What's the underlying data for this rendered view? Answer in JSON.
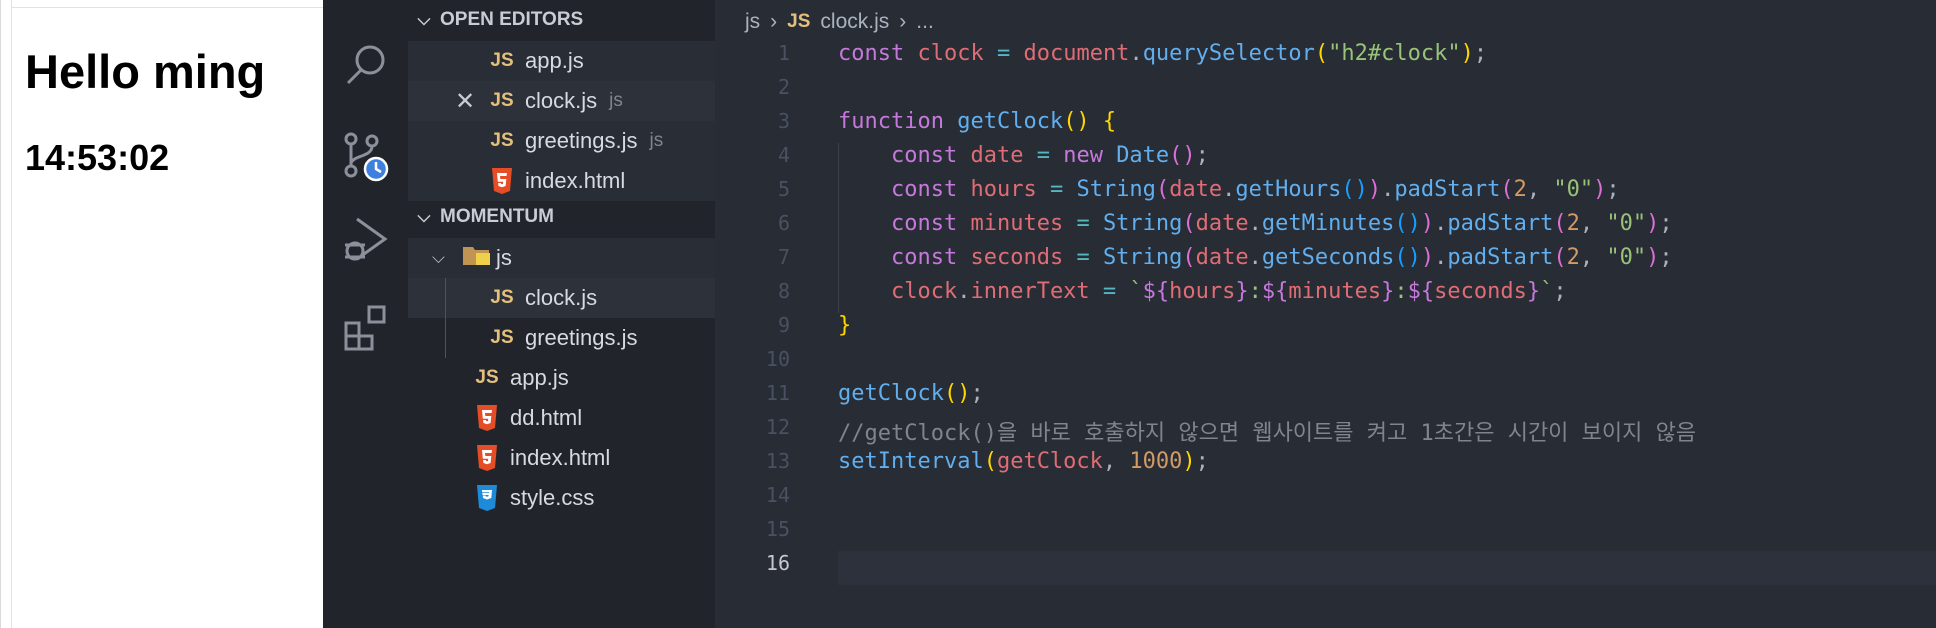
{
  "preview": {
    "heading": "Hello ming",
    "clock": "14:53:02"
  },
  "explorer": {
    "open_editors": {
      "title": "OPEN EDITORS",
      "items": [
        {
          "icon": "JS",
          "name": "app.js",
          "desc": ""
        },
        {
          "icon": "JS",
          "name": "clock.js",
          "desc": "js"
        },
        {
          "icon": "JS",
          "name": "greetings.js",
          "desc": "js"
        },
        {
          "icon": "html",
          "name": "index.html",
          "desc": ""
        }
      ]
    },
    "project": {
      "title": "MOMENTUM",
      "folder": "js",
      "items": [
        {
          "icon": "JS",
          "name": "clock.js"
        },
        {
          "icon": "JS",
          "name": "greetings.js"
        },
        {
          "icon": "JS",
          "name": "app.js"
        },
        {
          "icon": "html",
          "name": "dd.html"
        },
        {
          "icon": "html",
          "name": "index.html"
        },
        {
          "icon": "css",
          "name": "style.css"
        }
      ]
    }
  },
  "editor": {
    "breadcrumb": {
      "folder": "js",
      "file_icon": "JS",
      "file": "clock.js",
      "more": "..."
    },
    "current_line": 16,
    "lines": [
      [
        [
          "kw",
          "const "
        ],
        [
          "var",
          "clock "
        ],
        [
          "op",
          "= "
        ],
        [
          "var",
          "document"
        ],
        [
          "pl",
          "."
        ],
        [
          "fn",
          "querySelector"
        ],
        [
          "br1",
          "("
        ],
        [
          "str",
          "\"h2#clock\""
        ],
        [
          "br1",
          ")"
        ],
        [
          "pl",
          ";"
        ]
      ],
      [],
      [
        [
          "kw",
          "function "
        ],
        [
          "fn",
          "getClock"
        ],
        [
          "br1",
          "() {"
        ]
      ],
      [
        [
          "pl",
          "    "
        ],
        [
          "kw",
          "const "
        ],
        [
          "var",
          "date "
        ],
        [
          "op",
          "= "
        ],
        [
          "kw",
          "new "
        ],
        [
          "fn",
          "Date"
        ],
        [
          "br2",
          "()"
        ],
        [
          "pl",
          ";"
        ]
      ],
      [
        [
          "pl",
          "    "
        ],
        [
          "kw",
          "const "
        ],
        [
          "var",
          "hours "
        ],
        [
          "op",
          "= "
        ],
        [
          "fn",
          "String"
        ],
        [
          "br2",
          "("
        ],
        [
          "var",
          "date"
        ],
        [
          "pl",
          "."
        ],
        [
          "fn",
          "getHours"
        ],
        [
          "br3",
          "()"
        ],
        [
          "br2",
          ")"
        ],
        [
          "pl",
          "."
        ],
        [
          "fn",
          "padStart"
        ],
        [
          "br2",
          "("
        ],
        [
          "num",
          "2"
        ],
        [
          "pl",
          ", "
        ],
        [
          "str",
          "\"0\""
        ],
        [
          "br2",
          ")"
        ],
        [
          "pl",
          ";"
        ]
      ],
      [
        [
          "pl",
          "    "
        ],
        [
          "kw",
          "const "
        ],
        [
          "var",
          "minutes "
        ],
        [
          "op",
          "= "
        ],
        [
          "fn",
          "String"
        ],
        [
          "br2",
          "("
        ],
        [
          "var",
          "date"
        ],
        [
          "pl",
          "."
        ],
        [
          "fn",
          "getMinutes"
        ],
        [
          "br3",
          "()"
        ],
        [
          "br2",
          ")"
        ],
        [
          "pl",
          "."
        ],
        [
          "fn",
          "padStart"
        ],
        [
          "br2",
          "("
        ],
        [
          "num",
          "2"
        ],
        [
          "pl",
          ", "
        ],
        [
          "str",
          "\"0\""
        ],
        [
          "br2",
          ")"
        ],
        [
          "pl",
          ";"
        ]
      ],
      [
        [
          "pl",
          "    "
        ],
        [
          "kw",
          "const "
        ],
        [
          "var",
          "seconds "
        ],
        [
          "op",
          "= "
        ],
        [
          "fn",
          "String"
        ],
        [
          "br2",
          "("
        ],
        [
          "var",
          "date"
        ],
        [
          "pl",
          "."
        ],
        [
          "fn",
          "getSeconds"
        ],
        [
          "br3",
          "()"
        ],
        [
          "br2",
          ")"
        ],
        [
          "pl",
          "."
        ],
        [
          "fn",
          "padStart"
        ],
        [
          "br2",
          "("
        ],
        [
          "num",
          "2"
        ],
        [
          "pl",
          ", "
        ],
        [
          "str",
          "\"0\""
        ],
        [
          "br2",
          ")"
        ],
        [
          "pl",
          ";"
        ]
      ],
      [
        [
          "pl",
          "    "
        ],
        [
          "var",
          "clock"
        ],
        [
          "pl",
          "."
        ],
        [
          "var",
          "innerText "
        ],
        [
          "op",
          "= "
        ],
        [
          "str",
          "`"
        ],
        [
          "kw",
          "${"
        ],
        [
          "var",
          "hours"
        ],
        [
          "kw",
          "}"
        ],
        [
          "str",
          ":"
        ],
        [
          "kw",
          "${"
        ],
        [
          "var",
          "minutes"
        ],
        [
          "kw",
          "}"
        ],
        [
          "str",
          ":"
        ],
        [
          "kw",
          "${"
        ],
        [
          "var",
          "seconds"
        ],
        [
          "kw",
          "}"
        ],
        [
          "str",
          "`"
        ],
        [
          "pl",
          ";"
        ]
      ],
      [
        [
          "br1",
          "}"
        ]
      ],
      [],
      [
        [
          "fn",
          "getClock"
        ],
        [
          "br1",
          "()"
        ],
        [
          "pl",
          ";"
        ]
      ],
      [
        [
          "cm",
          "//getClock()을 바로 호출하지 않으면 웹사이트를 켜고 1초간은 시간이 보이지 않음"
        ]
      ],
      [
        [
          "fn",
          "setInterval"
        ],
        [
          "br1",
          "("
        ],
        [
          "var",
          "getClock"
        ],
        [
          "pl",
          ", "
        ],
        [
          "num",
          "1000"
        ],
        [
          "br1",
          ")"
        ],
        [
          "pl",
          ";"
        ]
      ],
      [],
      [],
      []
    ]
  }
}
